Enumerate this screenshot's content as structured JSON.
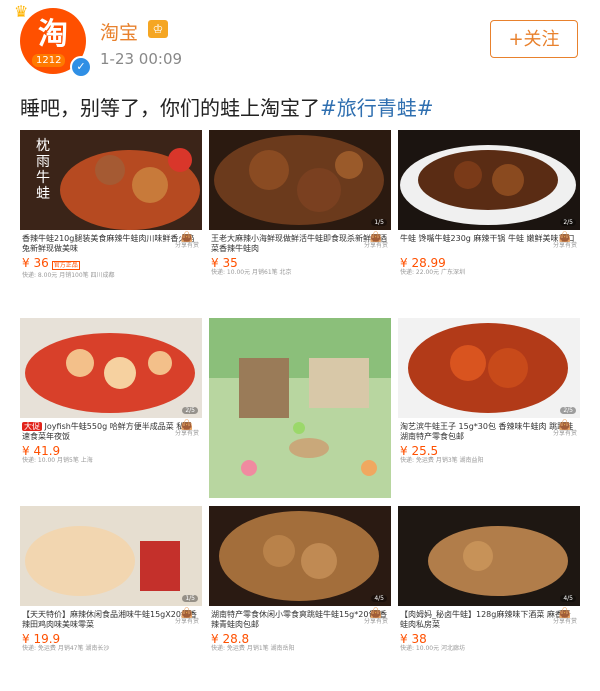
{
  "account": {
    "name": "淘宝",
    "time": "1-23 00:09",
    "avatar_logo": "淘",
    "avatar_promo": "1212",
    "follow_label": "+关注"
  },
  "post": {
    "text": "睡吧，别等了，你们的蛙上淘宝了",
    "hashtag": "#旅行青蛙#"
  },
  "products": [
    {
      "title": "香辣牛蛙210g腿装美食麻辣牛蛙肉川味鲜香火焰兔新鲜现做美味",
      "price": "¥ 36",
      "tag": "官方正品",
      "meta": "快递: 8.00元 月销100笔 四川成都",
      "share": "分享有赏",
      "overlay": "枕雨牛蛙"
    },
    {
      "title": "王老大麻辣小海鲜现做鲜活牛蛙即食现杀新鲜下酒菜香辣牛蛙肉",
      "price": "¥ 35",
      "tag": "",
      "meta": "快递: 10.00元 月销61笔 北京",
      "share": "分享有赏",
      "overlay": ""
    },
    {
      "title": "牛蛙 馋嘴牛蛙230g 麻辣干锅 牛蛙 嫩鲜美味可口",
      "price": "¥ 28.99",
      "tag": "",
      "meta": "快递: 22.00元 广东深圳",
      "share": "分享有赏",
      "overlay": ""
    },
    {
      "title": "Joyfish牛蛙550g 哈鲜方便半成品菜 私房速食菜年夜饭",
      "price": "¥ 41.9",
      "tag": "",
      "meta": "快递: 10.00 月销5笔 上海",
      "share": "分享有赏",
      "overlay": ""
    },
    {
      "title": "",
      "price": "",
      "tag": "",
      "meta": "",
      "share": "",
      "overlay": ""
    },
    {
      "title": "淘艺滨牛蛙王子 15g*30包 香辣味牛蛙肉 跳跳蛙 湖南特产零食包邮",
      "price": "¥ 25.5",
      "tag": "",
      "meta": "快递: 免运费 月销3笔 湖南益阳",
      "share": "分享有赏",
      "overlay": ""
    },
    {
      "title": "【天天特价】麻辣休闲食品湘味牛蛙15gX20袋香辣田鸡肉味美味零菜",
      "price": "¥ 19.9",
      "tag": "",
      "meta": "快递: 免运费 月销47笔 湖南长沙",
      "share": "分享有赏",
      "overlay": ""
    },
    {
      "title": "湖南特产零食休闲小零食爽跳蛙牛蛙15g*20包 香辣青蛙肉包邮",
      "price": "¥ 28.8",
      "tag": "",
      "meta": "快递: 免运费 月销1笔 湖南岳阳",
      "share": "分享有赏",
      "overlay": ""
    },
    {
      "title": "【肉姆妈_秘卤牛蛙】128g麻辣味下酒菜 麻香青蛙肉私房菜",
      "price": "¥ 38",
      "tag": "",
      "meta": "快递: 10.00元 河北廊坊",
      "share": "分享有赏",
      "overlay": ""
    }
  ],
  "colors": {
    "accent": "#e8812d",
    "price": "#ff5000",
    "hashtag": "#2f6fb0"
  },
  "icons": {
    "badge": "crown-badge-icon",
    "verify": "verified-icon",
    "share": "shopping-bag-icon"
  }
}
